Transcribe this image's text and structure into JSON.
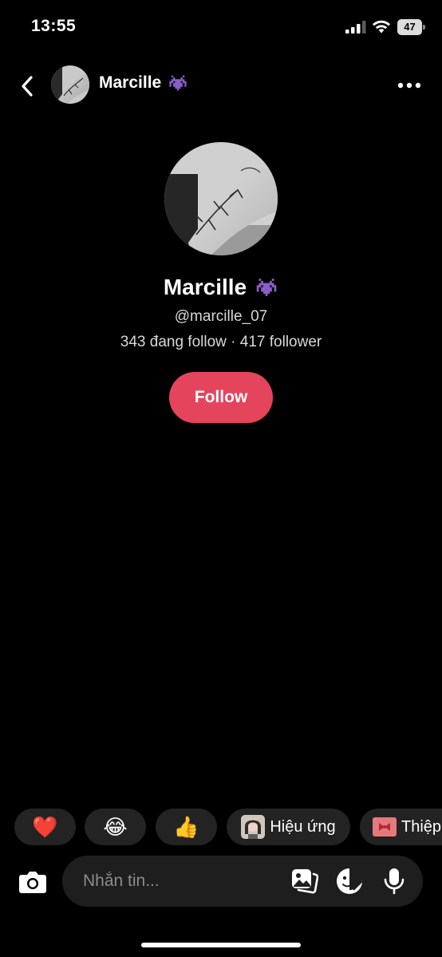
{
  "status_bar": {
    "time": "13:55",
    "battery_level": "47"
  },
  "header": {
    "name": "Marcille",
    "name_emoji_icon": "alien-monster-icon"
  },
  "profile": {
    "display_name": "Marcille",
    "name_emoji_icon": "alien-monster-icon",
    "handle": "@marcille_07",
    "stats": "343 đang follow · 417 follower",
    "follow_label": "Follow"
  },
  "quick_replies": [
    {
      "kind": "emoji",
      "icon": "red-heart-icon",
      "glyph": "❤️"
    },
    {
      "kind": "emoji",
      "icon": "tears-of-joy-icon",
      "glyph": "😂"
    },
    {
      "kind": "emoji",
      "icon": "thumbs-up-icon",
      "glyph": "👍"
    },
    {
      "kind": "effect",
      "label": "Hiệu ứng"
    },
    {
      "kind": "card",
      "label": "Thiệp"
    }
  ],
  "composer": {
    "placeholder": "Nhắn tin..."
  },
  "colors": {
    "background": "#000000",
    "accent_follow": "#e5445d",
    "chip_background": "#232323",
    "input_background": "#1e1e1e"
  }
}
